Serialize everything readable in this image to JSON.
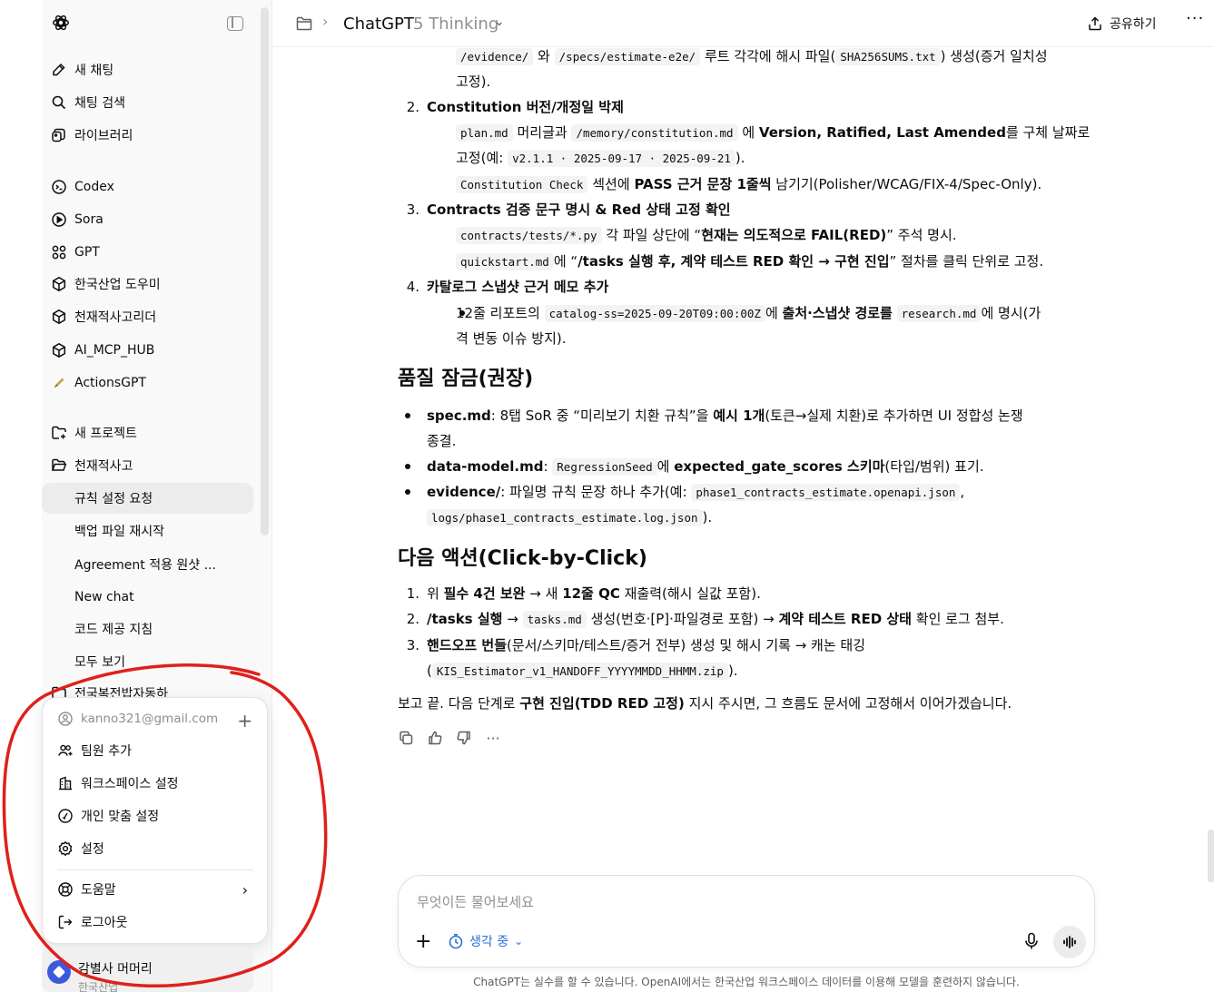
{
  "sidebar": {
    "items": [
      {
        "label": "새 채팅",
        "icon": "edit-icon"
      },
      {
        "label": "채팅 검색",
        "icon": "search-icon"
      },
      {
        "label": "라이브러리",
        "icon": "library-icon"
      },
      {
        "label": "Codex",
        "icon": "codex-icon"
      },
      {
        "label": "Sora",
        "icon": "sora-icon"
      },
      {
        "label": "GPT",
        "icon": "gpt-grid-icon"
      },
      {
        "label": "한국산업 도우미",
        "icon": "cube-icon"
      },
      {
        "label": "천재적사고리더",
        "icon": "cube-icon"
      },
      {
        "label": "AI_MCP_HUB",
        "icon": "cube-icon"
      },
      {
        "label": "ActionsGPT",
        "icon": "actionsgpt-icon"
      },
      {
        "label": "새 프로젝트",
        "icon": "new-folder-icon"
      },
      {
        "label": "천재적사고",
        "icon": "folder-open-icon"
      }
    ],
    "chats": [
      "규칙 설정 요청",
      "백업 파일 재시작",
      "Agreement 적용 원샷 ...",
      "New chat",
      "코드 제공 지침",
      "모두 보기",
      "전국복전밥자동하"
    ]
  },
  "account_menu": {
    "email": "kanno321@gmail.com",
    "items": [
      "팀원 추가",
      "워크스페이스 설정",
      "개인 맞춤 설정",
      "설정",
      "도움말",
      "로그아웃"
    ]
  },
  "user": {
    "name": "감별사 머머리",
    "org": "한국산업"
  },
  "header": {
    "title": "ChatGPT",
    "model": "5 Thinking",
    "share": "공유하기"
  },
  "content": {
    "l1_code1": "/evidence/",
    "l1_t1": "와",
    "l1_code2": "/specs/estimate-e2e/",
    "l1_t2": "루트 각각에 해시 파일(",
    "l1_code3": "SHA256SUMS.txt",
    "l1_t3": ") 생성(증거 일치성",
    "l2": "고정).",
    "n2": "2.",
    "h2": "Constitution 버전/개정일 박제",
    "b21_code1": "plan.md",
    "b21_t1": "머리글과",
    "b21_code2": "/memory/constitution.md",
    "b21_t2": "에",
    "b21_bold": "Version, Ratified, Last Amended",
    "b21_t3": "를 구체 날짜로",
    "b21b_t1": "고정(예:",
    "b21b_code": "v2.1.1 · 2025-09-17 · 2025-09-21",
    "b21b_t2": ").",
    "b22_code": "Constitution Check",
    "b22_t1": "섹션에",
    "b22_bold": "PASS 근거 문장 1줄씩",
    "b22_t2": "남기기(Polisher/WCAG/FIX-4/Spec-Only).",
    "n3": "3.",
    "h3": "Contracts 검증 문구 명시 & Red 상태 고정 확인",
    "b31_code": "contracts/tests/*.py",
    "b31_t1": "각 파일 상단에 “",
    "b31_bold": "현재는 의도적으로 FAIL(RED)",
    "b31_t2": "” 주석 명시.",
    "b32_code": "quickstart.md",
    "b32_t1": "에 “",
    "b32_bold": "/tasks 실행 후, 계약 테스트 RED 확인 → 구현 진입",
    "b32_t2": "” 절차를 클릭 단위로 고정.",
    "n4": "4.",
    "h4": "카탈로그 스냅샷 근거 메모 추가",
    "b41_t1": "12줄 리포트의",
    "b41_code1": "catalog-ss=2025-09-20T09:00:00Z",
    "b41_t2": "에",
    "b41_bold": "출처·스냅샷 경로를",
    "b41_code2": "research.md",
    "b41_t3": "에 명시(가",
    "b41b": "격 변동 이슈 방지).",
    "sec1": "품질 잠금(권장)",
    "q1_bold": "spec.md",
    "q1_t1": ": 8탭 SoR 중 “미리보기 치환 규칙”을",
    "q1_bold2": "예시 1개",
    "q1_t2": "(토큰→실제 치환)로 추가하면 UI 정합성 논쟁",
    "q1b": "종결.",
    "q2_bold": "data-model.md",
    "q2_t1": ":",
    "q2_code": "RegressionSeed",
    "q2_t2": "에",
    "q2_bold2": "expected_gate_scores 스키마",
    "q2_t3": "(타입/범위) 표기.",
    "q3_bold": "evidence/",
    "q3_t1": ": 파일명 규칙 문장 하나 추가(예:",
    "q3_code": "phase1_contracts_estimate.openapi.json",
    "q3_t2": ",",
    "q3b_code": "logs/phase1_contracts_estimate.log.json",
    "q3b_t": ").",
    "sec2": "다음 액션(Click-by-Click)",
    "a1_n": "1.",
    "a1_t1": "위",
    "a1_bold": "필수 4건 보완",
    "a1_t2": "→ 새",
    "a1_bold2": "12줄 QC",
    "a1_t3": "재출력(해시 실값 포함).",
    "a2_n": "2.",
    "a2_bold": "/tasks 실행",
    "a2_t1": "→",
    "a2_code": "tasks.md",
    "a2_t2": "생성(번호·[P]·파일경로 포함) →",
    "a2_bold2": "계약 테스트 RED 상태",
    "a2_t3": "확인 로그 첨부.",
    "a3_n": "3.",
    "a3_bold": "핸드오프 번들",
    "a3_t1": "(문서/스키마/테스트/증거 전부) 생성 및 해시 기록 → 캐논 태깅",
    "a3b_t1": "(",
    "a3b_code": "KIS_Estimator_v1_HANDOFF_YYYYMMDD_HHMM.zip",
    "a3b_t2": ").",
    "f_t1": "보고 끝. 다음 단계로",
    "f_bold": "구현 진입(TDD RED 고정)",
    "f_t2": "지시 주시면, 그 흐름도 문서에 고정해서 이어가겠습니다."
  },
  "composer": {
    "placeholder": "무엇이든 물어보세요",
    "thinking": "생각 중",
    "disclaimer": "ChatGPT는 실수를 할 수 있습니다. OpenAI에서는 한국산업 워크스페이스 데이터를 이용해 모델을 훈련하지 않습니다."
  },
  "colors": {
    "accent_blue": "#2f6fd6",
    "annotation_red": "#e0201b",
    "sidebar_bg": "#f9f9f9"
  }
}
